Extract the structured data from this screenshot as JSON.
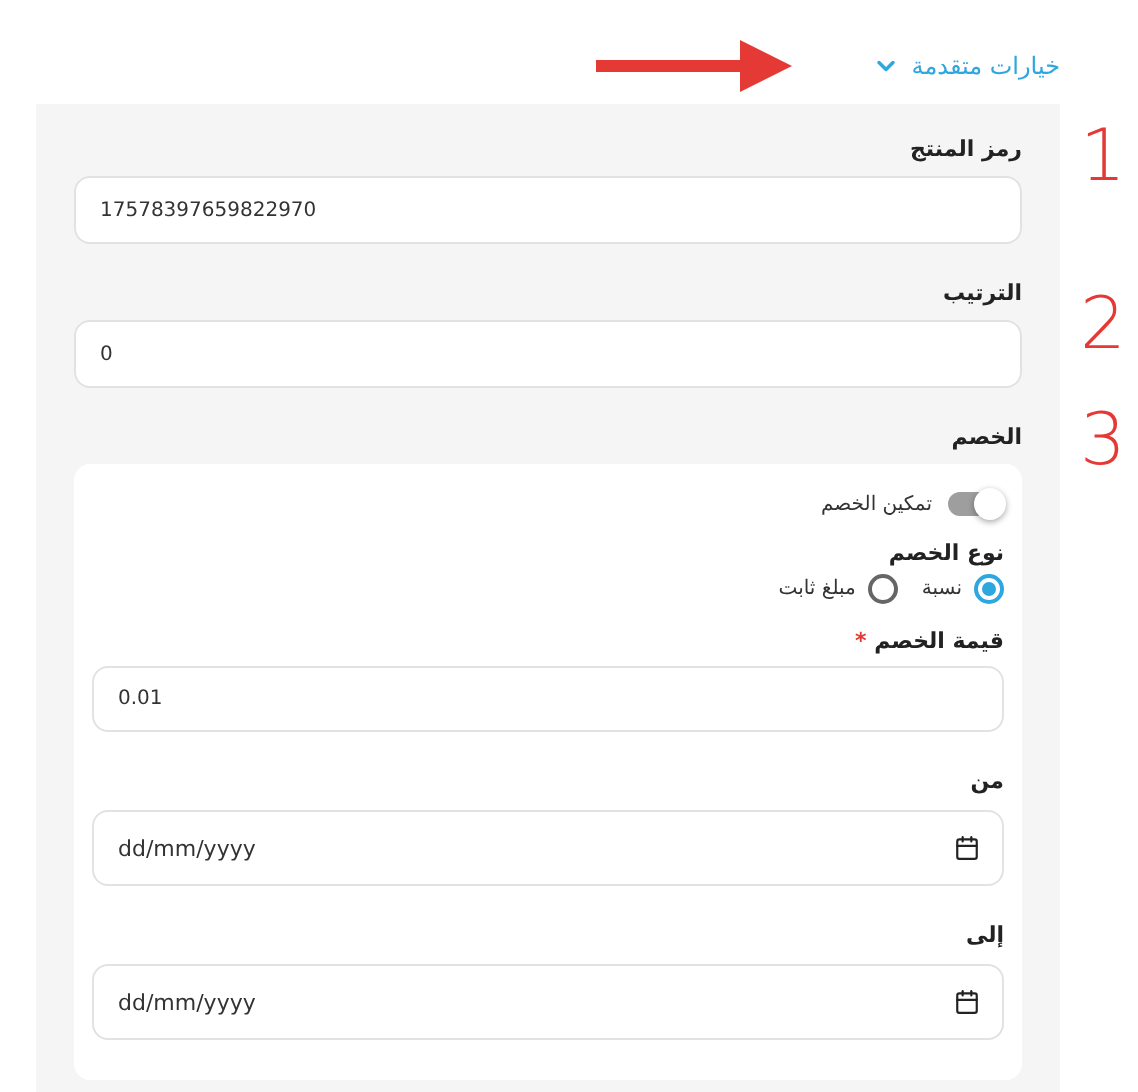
{
  "advanced_toggle": {
    "label": "خيارات متقدمة",
    "expanded": true
  },
  "annotations": [
    "1",
    "2",
    "3"
  ],
  "fields": [
    {
      "label": "رمز المنتج",
      "value": "17578397659822970"
    },
    {
      "label": "الترتيب",
      "value": "0"
    }
  ],
  "discount": {
    "label": "الخصم",
    "enable": {
      "label": "تمكين الخصم",
      "on": true
    },
    "type": {
      "label": "نوع الخصم",
      "options": [
        {
          "label": "نسبة",
          "selected": true
        },
        {
          "label": "مبلغ ثابت",
          "selected": false
        }
      ]
    },
    "value": {
      "label": "قيمة الخصم",
      "required": true,
      "required_mark": "*",
      "value": "0.01"
    },
    "dates": [
      {
        "label": "من",
        "placeholder": "dd/mm/yyyy"
      },
      {
        "label": "إلى",
        "placeholder": "dd/mm/yyyy"
      }
    ]
  }
}
